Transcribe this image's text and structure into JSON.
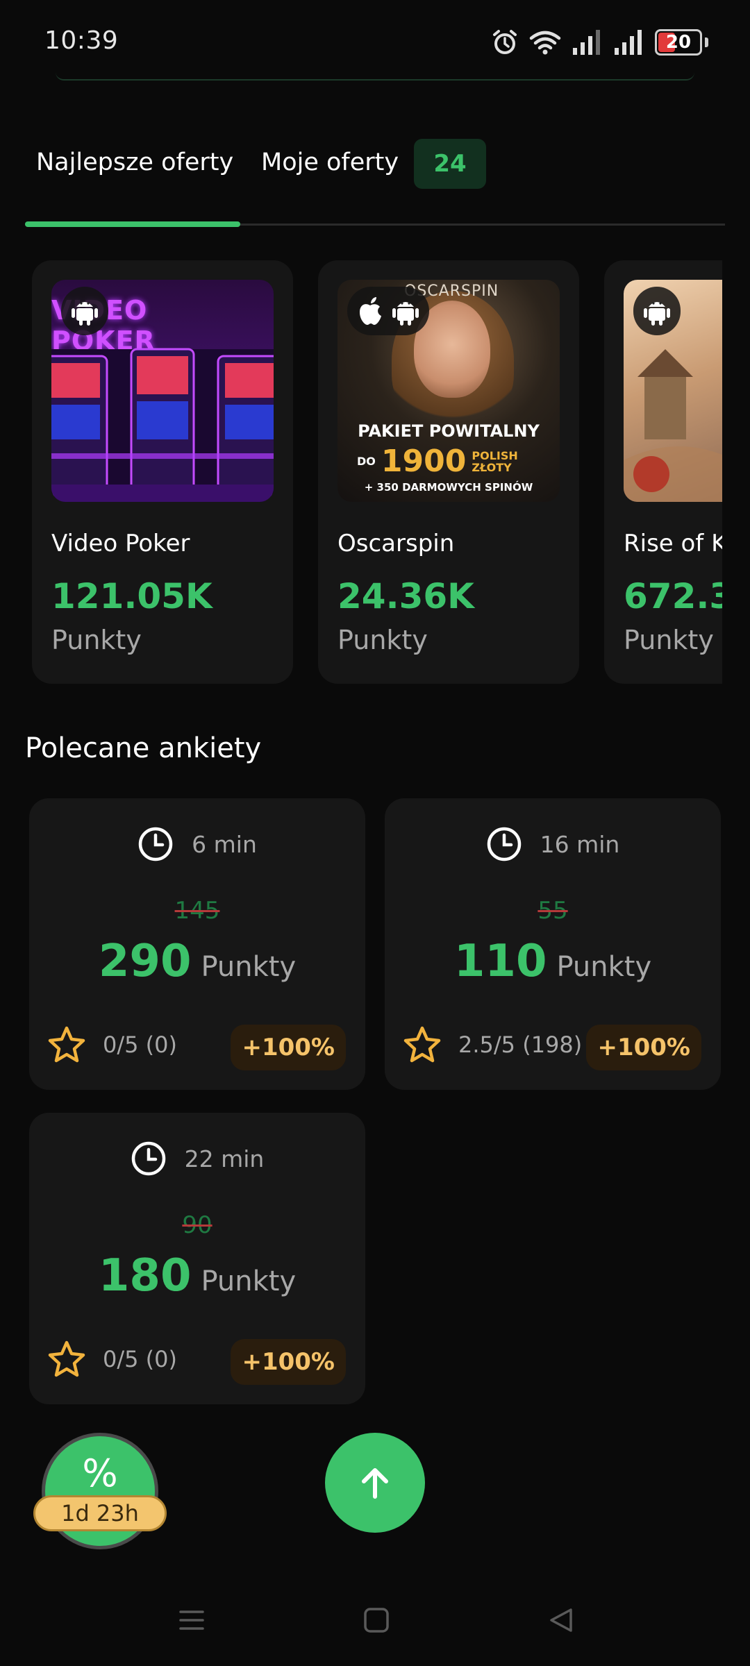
{
  "status_bar": {
    "time": "10:39",
    "battery": "20"
  },
  "tabs": {
    "best": "Najlepsze oferty",
    "mine": "Moje oferty",
    "mine_count": "24"
  },
  "offers": [
    {
      "name": "Video Poker",
      "points": "121.05K",
      "unit": "Punkty",
      "platforms": [
        "android-icon"
      ],
      "thumb_title": "VIDEO POKER"
    },
    {
      "name": "Oscarspin",
      "points": "24.36K",
      "unit": "Punkty",
      "platforms": [
        "apple-icon",
        "android-icon"
      ],
      "thumb_brand": "OSCARSPIN",
      "thumb_line1": "PAKIET POWITALNY",
      "thumb_do": "DO",
      "thumb_amount": "1900",
      "thumb_currency1": "POLISH",
      "thumb_currency2": "ZŁOTY",
      "thumb_line3": "+ 350 DARMOWYCH SPINÓW"
    },
    {
      "name": "Rise of K",
      "points": "672.3",
      "unit": "Punkty",
      "platforms": [
        "android-icon"
      ]
    }
  ],
  "surveys_title": "Polecane ankiety",
  "surveys": [
    {
      "time": "6 min",
      "old_points": "145",
      "points": "290",
      "unit": "Punkty",
      "rating": "0/5 (0)",
      "bonus": "+100%"
    },
    {
      "time": "16 min",
      "old_points": "55",
      "points": "110",
      "unit": "Punkty",
      "rating": "2.5/5 (198)",
      "bonus": "+100%"
    },
    {
      "time": "22 min",
      "old_points": "90",
      "points": "180",
      "unit": "Punkty",
      "rating": "0/5 (0)",
      "bonus": "+100%"
    }
  ],
  "promo": {
    "symbol": "%",
    "timer": "1d 23h"
  },
  "colors": {
    "accent": "#3cc26a",
    "card": "#161616",
    "background": "#0a0a0a",
    "badge_text": "#f5c36a"
  }
}
